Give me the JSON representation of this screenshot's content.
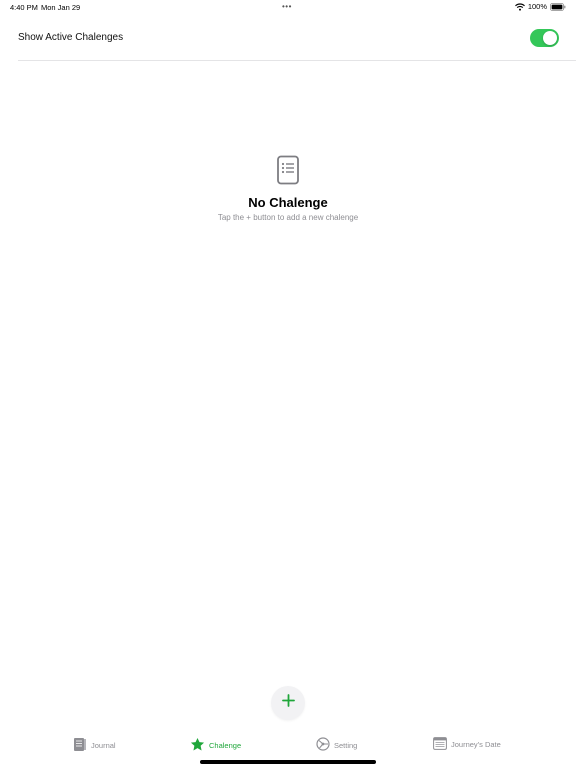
{
  "status_bar": {
    "time": "4:40 PM",
    "date": "Mon Jan 29",
    "dots": "•••",
    "battery": "100%"
  },
  "settings": {
    "show_active_label": "Show Active Chalenges",
    "show_active_enabled": true
  },
  "empty_state": {
    "icon": "list-document-icon",
    "title": "No Chalenge",
    "subtitle": "Tap the + button to add a new chalenge"
  },
  "add_button": {
    "icon": "plus-icon"
  },
  "tabs": [
    {
      "label": "Journal",
      "icon": "journal-icon",
      "active": false
    },
    {
      "label": "Chalenge",
      "icon": "star-icon",
      "active": true
    },
    {
      "label": "Setting",
      "icon": "setting-icon",
      "active": false
    },
    {
      "label": "Journey's Date",
      "icon": "calendar-icon",
      "active": false
    }
  ],
  "colors": {
    "accent_green": "#1fa63a",
    "toggle_green": "#34c759",
    "inactive_gray": "#8e8e93"
  }
}
